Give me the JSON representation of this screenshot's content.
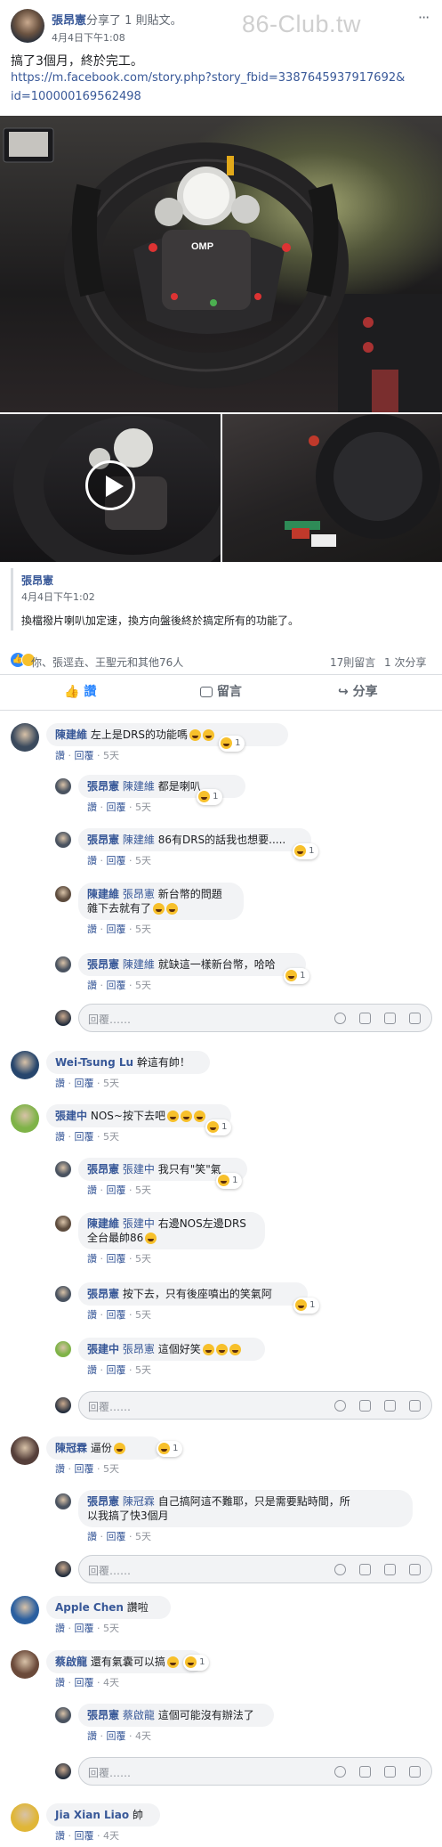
{
  "watermark": "86-Club.tw",
  "post": {
    "author": "張昂憲",
    "shared_text": "分享了",
    "shared_count": "1 則貼文。",
    "time": "4月4日下午1:08",
    "body": "搞了3個月，終於完工。",
    "link_line1": "https://m.facebook.com/story.php?story_fbid=3387645937917692&",
    "link_line2": "id=100000169562498"
  },
  "shared": {
    "author": "張昂憲",
    "time": "4月4日下午1:02",
    "body": "換檔撥片喇叭加定速，換方向盤後終於搞定所有的功能了。"
  },
  "summary": {
    "reactors": "你、張逕垚、王聖元和其他76人",
    "comments": "17則留言",
    "shares": "1 次分享"
  },
  "actions": {
    "like": "讚",
    "comment": "留言",
    "share": "分享"
  },
  "common": {
    "like": "讚",
    "reply": "回覆",
    "reply_placeholder": "回覆……"
  },
  "comments": [
    {
      "name": "陳建維",
      "text": "左上是DRS的功能嗎",
      "time": "5天",
      "count": "1"
    },
    {
      "name": "張昂憲",
      "tag": "陳建維",
      "text": "都是喇叭",
      "time": "5天",
      "count": "1"
    },
    {
      "name": "張昂憲",
      "tag": "陳建維",
      "text": "86有DRS的話我也想要.....",
      "time": "5天",
      "count": "1"
    },
    {
      "name": "陳建維",
      "tag": "張昂憲",
      "text": "新台幣的問題",
      "text2": "雜下去就有了",
      "time": "5天"
    },
    {
      "name": "張昂憲",
      "tag": "陳建維",
      "text": "就缺這一樣新台幣，哈哈",
      "time": "5天",
      "count": "1"
    },
    {
      "name": "Wei-Tsung Lu",
      "text": "幹這有帥！",
      "time": "5天"
    },
    {
      "name": "張建中",
      "text": "NOS~按下去吧",
      "time": "5天",
      "count": "1"
    },
    {
      "name": "張昂憲",
      "tag": "張建中",
      "text": "我只有\"笑\"氣",
      "time": "5天",
      "count": "1"
    },
    {
      "name": "陳建維",
      "tag": "張建中",
      "text": "右邊NOS左邊DRS",
      "text2": "全台最帥86",
      "time": "5天"
    },
    {
      "name": "張昂憲",
      "text": "按下去，只有後座噴出的笑氣阿",
      "time": "5天",
      "count": "1"
    },
    {
      "name": "張建中",
      "tag": "張昂憲",
      "text": "這個好笑",
      "time": "5天"
    },
    {
      "name": "陳冠霖",
      "text": "逼份",
      "time": "5天",
      "count": "1"
    },
    {
      "name": "張昂憲",
      "tag": "陳冠霖",
      "text": "自己搞阿這不難耶，只是需要點時間，所",
      "text2": "以我搞了快3個月",
      "time": "5天"
    },
    {
      "name": "Apple Chen",
      "text": "讚啦",
      "time": "5天"
    },
    {
      "name": "蔡啟龍",
      "text": "還有氣囊可以搞",
      "time": "4天",
      "count": "1"
    },
    {
      "name": "張昂憲",
      "tag": "蔡啟龍",
      "text": "這個可能沒有辦法了",
      "time": "4天"
    },
    {
      "name": "Jia Xian Liao",
      "text": "帥",
      "time": "4天"
    }
  ],
  "colors": {
    "link": "#385898",
    "like_blue": "#2d88ff",
    "bubble": "#f2f3f5"
  }
}
